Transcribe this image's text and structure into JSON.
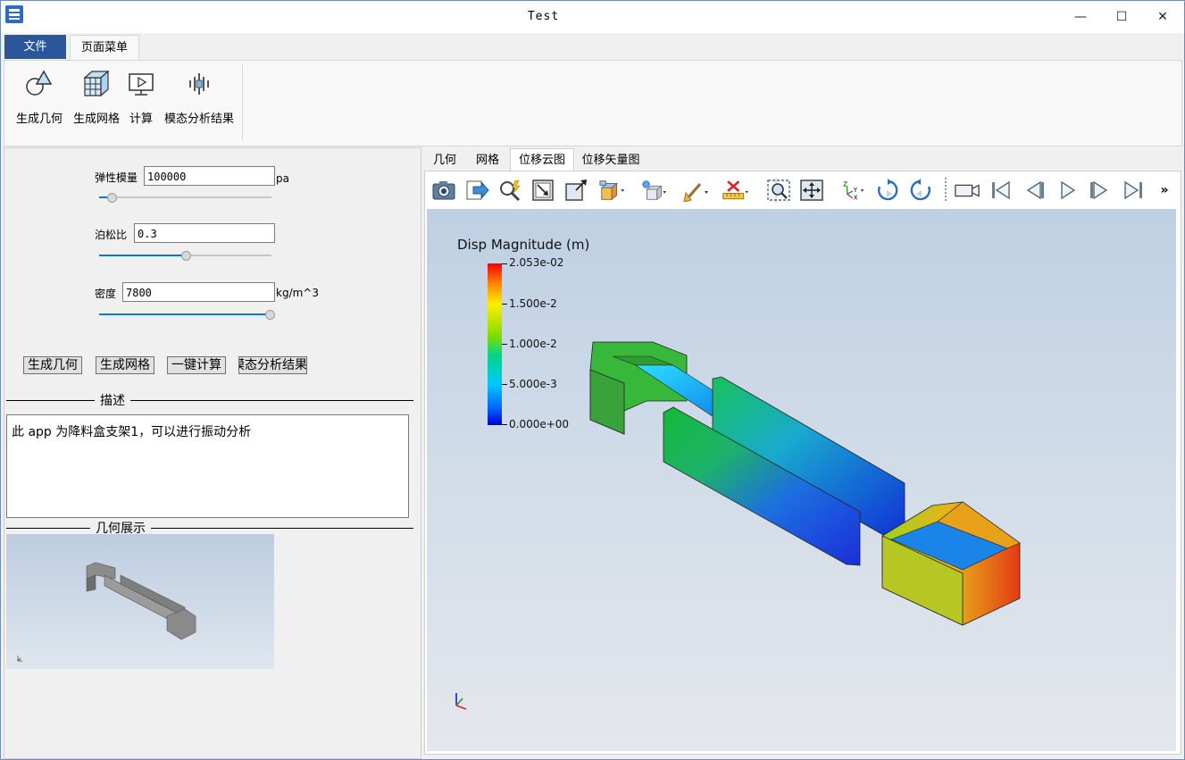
{
  "window": {
    "title": "Test",
    "controls": [
      "—",
      "☐",
      "✕"
    ]
  },
  "ribbon": {
    "tabs": [
      "文件",
      "页面菜单"
    ],
    "items": [
      {
        "label": "生成几何",
        "icon": "geometry-shapes-icon"
      },
      {
        "label": "生成网格",
        "icon": "mesh-cube-icon"
      },
      {
        "label": "计算",
        "icon": "monitor-play-icon"
      },
      {
        "label": "模态分析结果",
        "icon": "modal-bars-icon"
      }
    ]
  },
  "form": {
    "elastic": {
      "label": "弹性模量",
      "value": "100000",
      "unit": "pa",
      "slider": 0.07
    },
    "poisson": {
      "label": "泊松比",
      "value": "0.3",
      "unit": "",
      "slider": 0.5
    },
    "density": {
      "label": "密度",
      "value": "7800",
      "unit": "kg/m^3",
      "slider": 0.99
    }
  },
  "buttons": [
    "生成几何",
    "生成网格",
    "一键计算",
    "模态分析结果"
  ],
  "description": {
    "title": "描述",
    "text": "此 app 为降料盒支架1，可以进行振动分析"
  },
  "geometry": {
    "title": "几何展示"
  },
  "right_tabs": [
    "几何",
    "网格",
    "位移云图",
    "位移矢量图"
  ],
  "toolbar_icons": [
    "camera-icon",
    "export-icon",
    "pick-icon",
    "zoom-box-icon",
    "scale-icon",
    "view-cube-icon",
    "light-icon",
    "box-icon",
    "brush-icon",
    "ruler-icon",
    "zoom-select-icon",
    "fit-icon",
    "axes-icon",
    "rotate-cw-icon",
    "rotate-ccw-icon",
    "video-icon",
    "first-frame-icon",
    "prev-frame-icon",
    "play-icon",
    "next-frame-icon",
    "last-frame-icon",
    "more-icon"
  ],
  "legend": {
    "title": "Disp Magnitude (m)",
    "labels": [
      "2.053e-02",
      "1.500e-2",
      "1.000e-2",
      "5.000e-3",
      "0.000e+00"
    ],
    "colors": {
      "max": "#ff0000",
      "mid": "#7fdc00",
      "min": "#0000d0"
    }
  },
  "colors": {
    "accent": "#2b579a",
    "slider": "#0a78d7"
  }
}
